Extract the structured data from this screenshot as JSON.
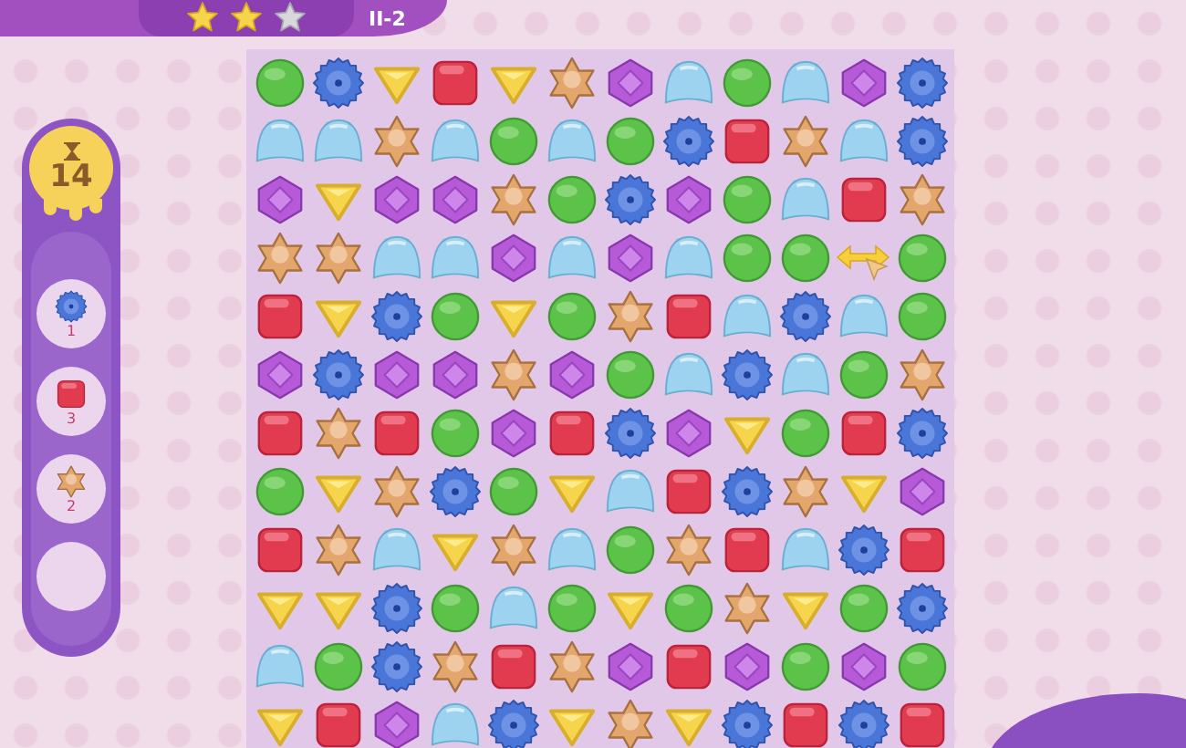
{
  "level_bar": {
    "stars": 2,
    "stage_label": "II-2"
  },
  "moves": {
    "count": "14"
  },
  "goals": [
    {
      "kind": "flower",
      "count": "1"
    },
    {
      "kind": "square",
      "count": "3"
    },
    {
      "kind": "star",
      "count": "2"
    },
    {
      "kind": "empty"
    }
  ],
  "board": {
    "rows": [
      [
        {
          "kind": "ball"
        },
        {
          "kind": "flower"
        },
        {
          "kind": "triangle"
        },
        {
          "kind": "square"
        },
        {
          "kind": "triangle"
        },
        {
          "kind": "star"
        },
        {
          "kind": "hexagon"
        },
        {
          "kind": "jelly"
        },
        {
          "kind": "ball"
        },
        {
          "kind": "jelly"
        },
        {
          "kind": "hexagon"
        },
        {
          "kind": "flower"
        }
      ],
      [
        {
          "kind": "jelly"
        },
        {
          "kind": "jelly"
        },
        {
          "kind": "star"
        },
        {
          "kind": "jelly"
        },
        {
          "kind": "ball"
        },
        {
          "kind": "jelly"
        },
        {
          "kind": "ball"
        },
        {
          "kind": "flower"
        },
        {
          "kind": "square"
        },
        {
          "kind": "star"
        },
        {
          "kind": "jelly"
        },
        {
          "kind": "flower"
        }
      ],
      [
        {
          "kind": "hexagon"
        },
        {
          "kind": "triangle"
        },
        {
          "kind": "hexagon"
        },
        {
          "kind": "hexagon"
        },
        {
          "kind": "star"
        },
        {
          "kind": "ball"
        },
        {
          "kind": "flower"
        },
        {
          "kind": "hexagon"
        },
        {
          "kind": "ball"
        },
        {
          "kind": "jelly"
        },
        {
          "kind": "square"
        },
        {
          "kind": "star"
        }
      ],
      [
        {
          "kind": "star"
        },
        {
          "kind": "star"
        },
        {
          "kind": "jelly"
        },
        {
          "kind": "jelly"
        },
        {
          "kind": "hexagon"
        },
        {
          "kind": "jelly"
        },
        {
          "kind": "hexagon"
        },
        {
          "kind": "jelly"
        },
        {
          "kind": "ball"
        },
        {
          "kind": "ball"
        },
        {
          "kind": "swap-hint"
        },
        {
          "kind": "ball"
        }
      ],
      [
        {
          "kind": "square"
        },
        {
          "kind": "triangle"
        },
        {
          "kind": "flower"
        },
        {
          "kind": "ball"
        },
        {
          "kind": "triangle"
        },
        {
          "kind": "ball"
        },
        {
          "kind": "star"
        },
        {
          "kind": "square"
        },
        {
          "kind": "jelly"
        },
        {
          "kind": "flower"
        },
        {
          "kind": "jelly"
        },
        {
          "kind": "ball"
        }
      ],
      [
        {
          "kind": "hexagon"
        },
        {
          "kind": "flower"
        },
        {
          "kind": "hexagon"
        },
        {
          "kind": "hexagon"
        },
        {
          "kind": "star"
        },
        {
          "kind": "hexagon"
        },
        {
          "kind": "ball"
        },
        {
          "kind": "jelly"
        },
        {
          "kind": "flower"
        },
        {
          "kind": "jelly"
        },
        {
          "kind": "ball"
        },
        {
          "kind": "star"
        }
      ],
      [
        {
          "kind": "square"
        },
        {
          "kind": "star"
        },
        {
          "kind": "square"
        },
        {
          "kind": "ball"
        },
        {
          "kind": "hexagon"
        },
        {
          "kind": "square"
        },
        {
          "kind": "flower"
        },
        {
          "kind": "hexagon"
        },
        {
          "kind": "triangle"
        },
        {
          "kind": "ball"
        },
        {
          "kind": "square"
        },
        {
          "kind": "flower"
        }
      ],
      [
        {
          "kind": "ball"
        },
        {
          "kind": "triangle"
        },
        {
          "kind": "star"
        },
        {
          "kind": "flower"
        },
        {
          "kind": "ball"
        },
        {
          "kind": "triangle"
        },
        {
          "kind": "jelly"
        },
        {
          "kind": "square"
        },
        {
          "kind": "flower"
        },
        {
          "kind": "star"
        },
        {
          "kind": "triangle"
        },
        {
          "kind": "hexagon"
        }
      ],
      [
        {
          "kind": "square"
        },
        {
          "kind": "star"
        },
        {
          "kind": "jelly"
        },
        {
          "kind": "triangle"
        },
        {
          "kind": "star"
        },
        {
          "kind": "jelly"
        },
        {
          "kind": "ball"
        },
        {
          "kind": "star"
        },
        {
          "kind": "square"
        },
        {
          "kind": "jelly"
        },
        {
          "kind": "flower"
        },
        {
          "kind": "square"
        }
      ],
      [
        {
          "kind": "triangle"
        },
        {
          "kind": "triangle"
        },
        {
          "kind": "flower"
        },
        {
          "kind": "ball"
        },
        {
          "kind": "jelly"
        },
        {
          "kind": "ball"
        },
        {
          "kind": "triangle"
        },
        {
          "kind": "ball"
        },
        {
          "kind": "star"
        },
        {
          "kind": "triangle"
        },
        {
          "kind": "ball"
        },
        {
          "kind": "flower"
        }
      ],
      [
        {
          "kind": "jelly"
        },
        {
          "kind": "ball"
        },
        {
          "kind": "flower"
        },
        {
          "kind": "star"
        },
        {
          "kind": "square"
        },
        {
          "kind": "star"
        },
        {
          "kind": "hexagon"
        },
        {
          "kind": "square"
        },
        {
          "kind": "hexagon"
        },
        {
          "kind": "ball"
        },
        {
          "kind": "hexagon"
        },
        {
          "kind": "ball"
        }
      ],
      [
        {
          "kind": "triangle"
        },
        {
          "kind": "square"
        },
        {
          "kind": "hexagon"
        },
        {
          "kind": "jelly"
        },
        {
          "kind": "flower"
        },
        {
          "kind": "triangle"
        },
        {
          "kind": "star"
        },
        {
          "kind": "triangle"
        },
        {
          "kind": "flower"
        },
        {
          "kind": "square"
        },
        {
          "kind": "flower"
        },
        {
          "kind": "square"
        }
      ]
    ]
  }
}
